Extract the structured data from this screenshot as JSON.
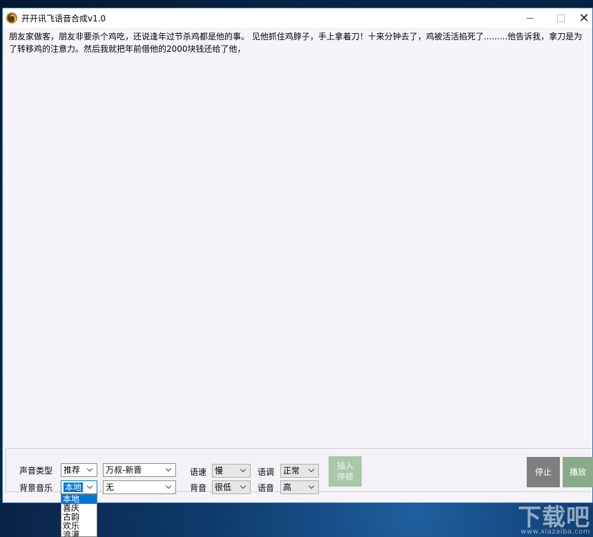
{
  "window": {
    "title": "开开讯飞语音合成v1.0"
  },
  "editor": {
    "text": "朋友家做客，朋友非要杀个鸡吃，还说逢年过节杀鸡都是他的事。 见他抓住鸡脖子，手上拿着刀！十来分钟去了，鸡被活活掐死了.........他告诉我，拿刀是为了转移鸡的注意力。然后我就把年前借他的2000块钱还给了他，"
  },
  "controls": {
    "voice_type_label": "声音类型",
    "voice_category": "推荐",
    "voice_name": "万叔-新晋",
    "bg_music_label": "背景音乐",
    "bg_music_source": "本地",
    "bg_music_track": "无",
    "speed_label": "语速",
    "speed_value": "慢",
    "bg_volume_label": "背音",
    "bg_volume_value": "很低",
    "pitch_label": "语调",
    "pitch_value": "正常",
    "volume_label": "语音",
    "volume_value": "高",
    "insert_pause_line1": "插入",
    "insert_pause_line2": "停顿",
    "stop_label": "停止",
    "play_label": "播放"
  },
  "bg_music_dropdown": {
    "options": [
      "本地",
      "喜庆",
      "古韵",
      "欢乐",
      "浪漫"
    ],
    "selected": "本地"
  },
  "watermark": {
    "text": "下载吧",
    "url": "www.xiazaiba.com"
  }
}
